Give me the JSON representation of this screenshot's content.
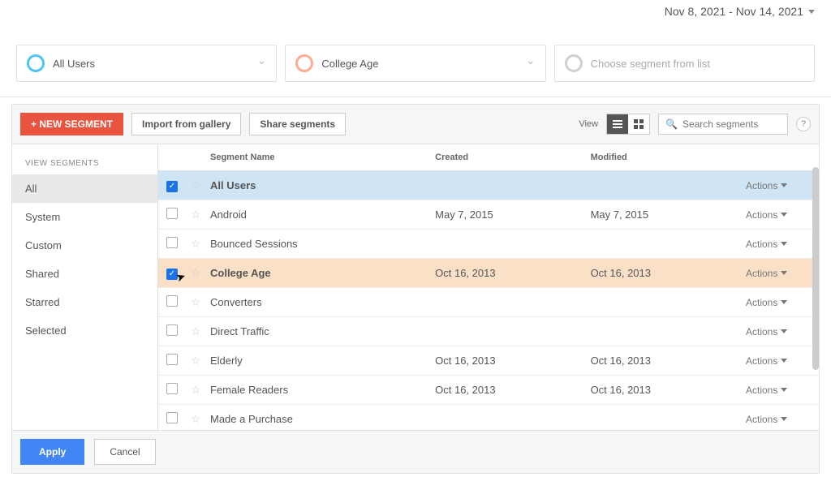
{
  "date_range": "Nov 8, 2021 - Nov 14, 2021",
  "pills": [
    {
      "label": "All Users",
      "ring": "blue"
    },
    {
      "label": "College Age",
      "ring": "orange"
    },
    {
      "label": "Choose segment from list",
      "ring": "grey",
      "faded": true
    }
  ],
  "toolbar": {
    "new_segment": "+ NEW SEGMENT",
    "import": "Import from gallery",
    "share": "Share segments",
    "view_label": "View",
    "search_placeholder": "Search segments"
  },
  "sidebar": {
    "title": "VIEW SEGMENTS",
    "items": [
      "All",
      "System",
      "Custom",
      "Shared",
      "Starred",
      "Selected"
    ],
    "active": 0
  },
  "columns": {
    "name": "Segment Name",
    "created": "Created",
    "modified": "Modified"
  },
  "actions_label": "Actions",
  "rows": [
    {
      "name": "All Users",
      "created": "",
      "modified": "",
      "checked": true,
      "highlight": "blue",
      "bold": true
    },
    {
      "name": "Android",
      "created": "May 7, 2015",
      "modified": "May 7, 2015"
    },
    {
      "name": "Bounced Sessions",
      "created": "",
      "modified": ""
    },
    {
      "name": "College Age",
      "created": "Oct 16, 2013",
      "modified": "Oct 16, 2013",
      "checked": true,
      "highlight": "orange",
      "bold": true
    },
    {
      "name": "Converters",
      "created": "",
      "modified": ""
    },
    {
      "name": "Direct Traffic",
      "created": "",
      "modified": ""
    },
    {
      "name": "Elderly",
      "created": "Oct 16, 2013",
      "modified": "Oct 16, 2013"
    },
    {
      "name": "Female Readers",
      "created": "Oct 16, 2013",
      "modified": "Oct 16, 2013"
    },
    {
      "name": "Made a Purchase",
      "created": "",
      "modified": ""
    }
  ],
  "footer": {
    "apply": "Apply",
    "cancel": "Cancel"
  }
}
